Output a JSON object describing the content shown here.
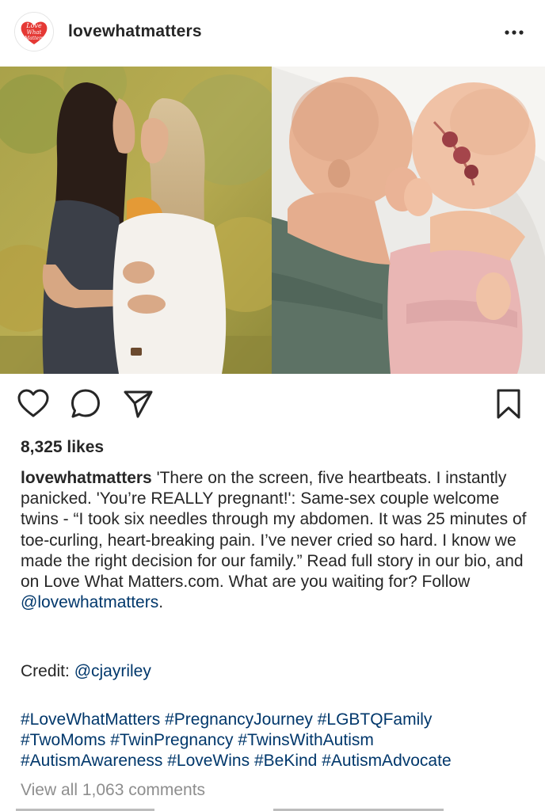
{
  "post": {
    "username": "lovewhatmatters",
    "avatar_logo_text": [
      "Love",
      "What",
      "Matters"
    ],
    "more_icon": "more-horizontal-icon",
    "media": {
      "left_photo": "two-women-outdoors",
      "right_photo": "newborn-twins-sleeping"
    },
    "actions": {
      "like_icon": "heart-outline-icon",
      "comment_icon": "comment-bubble-icon",
      "share_icon": "paper-plane-icon",
      "save_icon": "bookmark-outline-icon"
    },
    "likes": "8,325 likes",
    "caption": {
      "username": "lovewhatmatters",
      "text": " 'There on the screen, five heartbeats. I instantly panicked. 'You’re REALLY pregnant!': Same-sex couple welcome twins - “I took six needles through my abdomen. It was 25 minutes of toe-curling, heart-breaking pain. I’ve never cried so hard. I know we made the right decision for our family.” Read full story in our bio, and on Love What Matters.com. What are you waiting for? Follow ",
      "mention": "@lovewhatmatters",
      "end": "."
    },
    "credit": {
      "label": "Credit: ",
      "mention": "@cjayriley"
    },
    "hashtags": [
      "#LoveWhatMatters",
      "#PregnancyJourney",
      "#LGBTQFamily",
      "#TwoMoms",
      "#TwinPregnancy",
      "#TwinsWithAutism",
      "#AutismAwareness",
      "#LoveWins",
      "#BeKind",
      "#AutismAdvocate"
    ],
    "view_all_comments": "View all 1,063 comments"
  },
  "colors": {
    "text": "#262626",
    "link": "#00376b",
    "muted": "#8e8e8e",
    "logo_red": "#e53935"
  }
}
